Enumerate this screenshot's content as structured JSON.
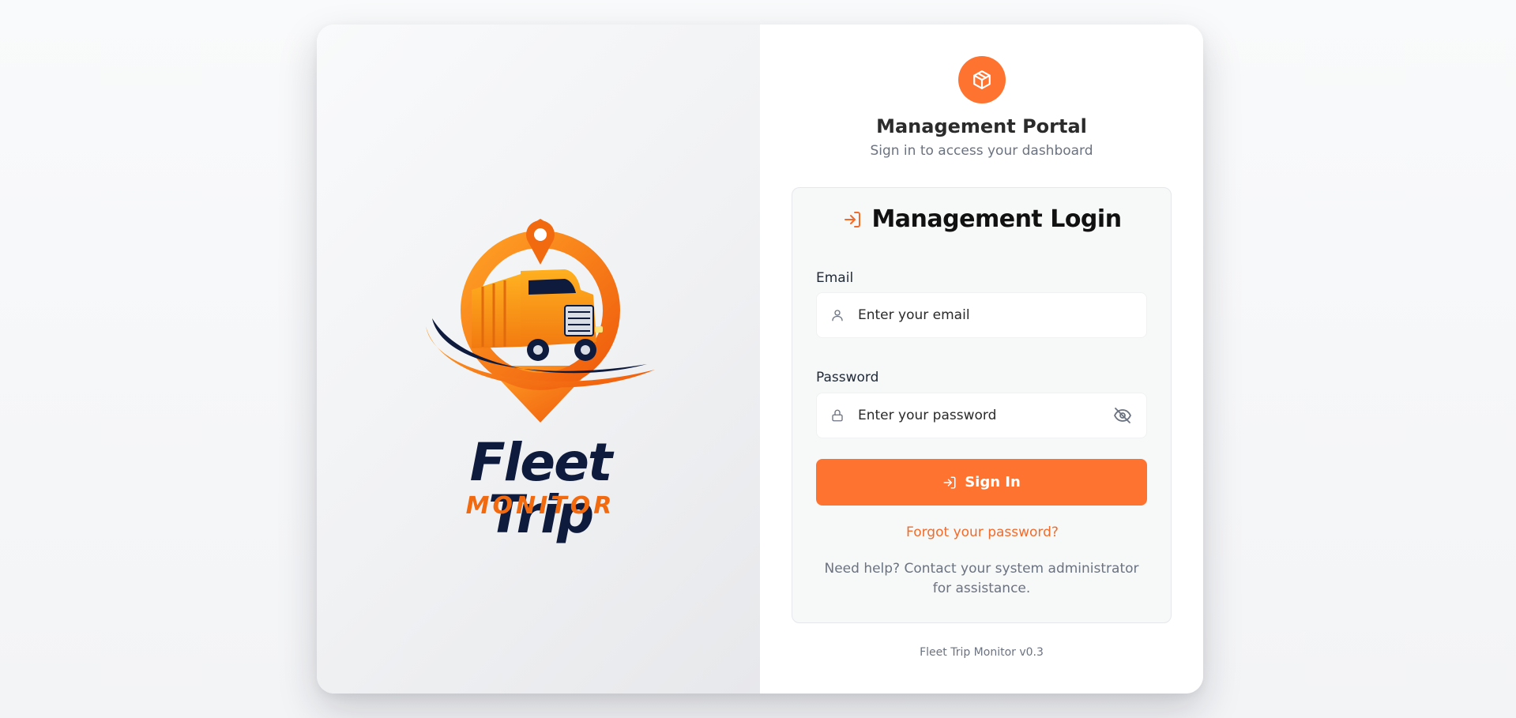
{
  "brand": {
    "logo_title": "Fleet Trip",
    "logo_subtitle": "MONITOR"
  },
  "portal": {
    "icon": "package-icon",
    "title": "Management Portal",
    "subtitle": "Sign in to access your dashboard"
  },
  "login": {
    "heading_icon": "sign-in-icon",
    "heading": "Management Login",
    "email": {
      "label": "Email",
      "placeholder": "Enter your email",
      "value": "",
      "icon": "user-icon"
    },
    "password": {
      "label": "Password",
      "placeholder": "Enter your password",
      "value": "",
      "icon": "lock-icon",
      "toggle_icon": "eye-off-icon"
    },
    "submit_label": "Sign In",
    "forgot_label": "Forgot your password?",
    "help_text": "Need help? Contact your system administrator for assistance."
  },
  "footer": {
    "version": "Fleet Trip Monitor v0.3"
  },
  "colors": {
    "accent": "#ff7331",
    "link": "#f26b2a",
    "brand_navy": "#0f1b3d"
  }
}
